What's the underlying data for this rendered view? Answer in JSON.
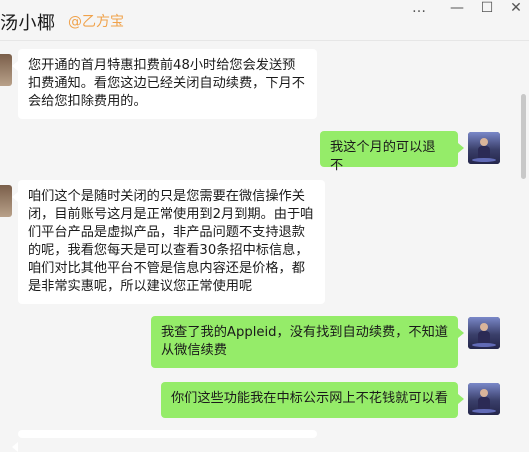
{
  "window": {
    "title": "汤小椰",
    "title_tag": "@乙方宝",
    "controls": {
      "more": "…",
      "minimize": "—",
      "maximize": "☐",
      "close": "✕"
    }
  },
  "messages": [
    {
      "side": "left",
      "text": "您开通的首月特惠扣费前48小时给您会发送预扣费通知。看您这边已经关闭自动续费，下月不会给您扣除费用的。"
    },
    {
      "side": "right",
      "text": "我这个月的可以退不"
    },
    {
      "side": "left",
      "text": "咱们这个是随时关闭的只是您需要在微信操作关闭，目前账号这月是正常使用到2月到期。由于咱们平台产品是虚拟产品，非产品问题不支持退款的呢，我看您每天是可以查看30条招中标信息，咱们对比其他平台不管是信息内容还是价格，都是非常实惠呢，所以建议您正常使用呢"
    },
    {
      "side": "right",
      "text": "我查了我的Appleid，没有找到自动续费，不知道从微信续费"
    },
    {
      "side": "right",
      "text": "你们这些功能我在中标公示网上不花钱就可以看"
    }
  ]
}
